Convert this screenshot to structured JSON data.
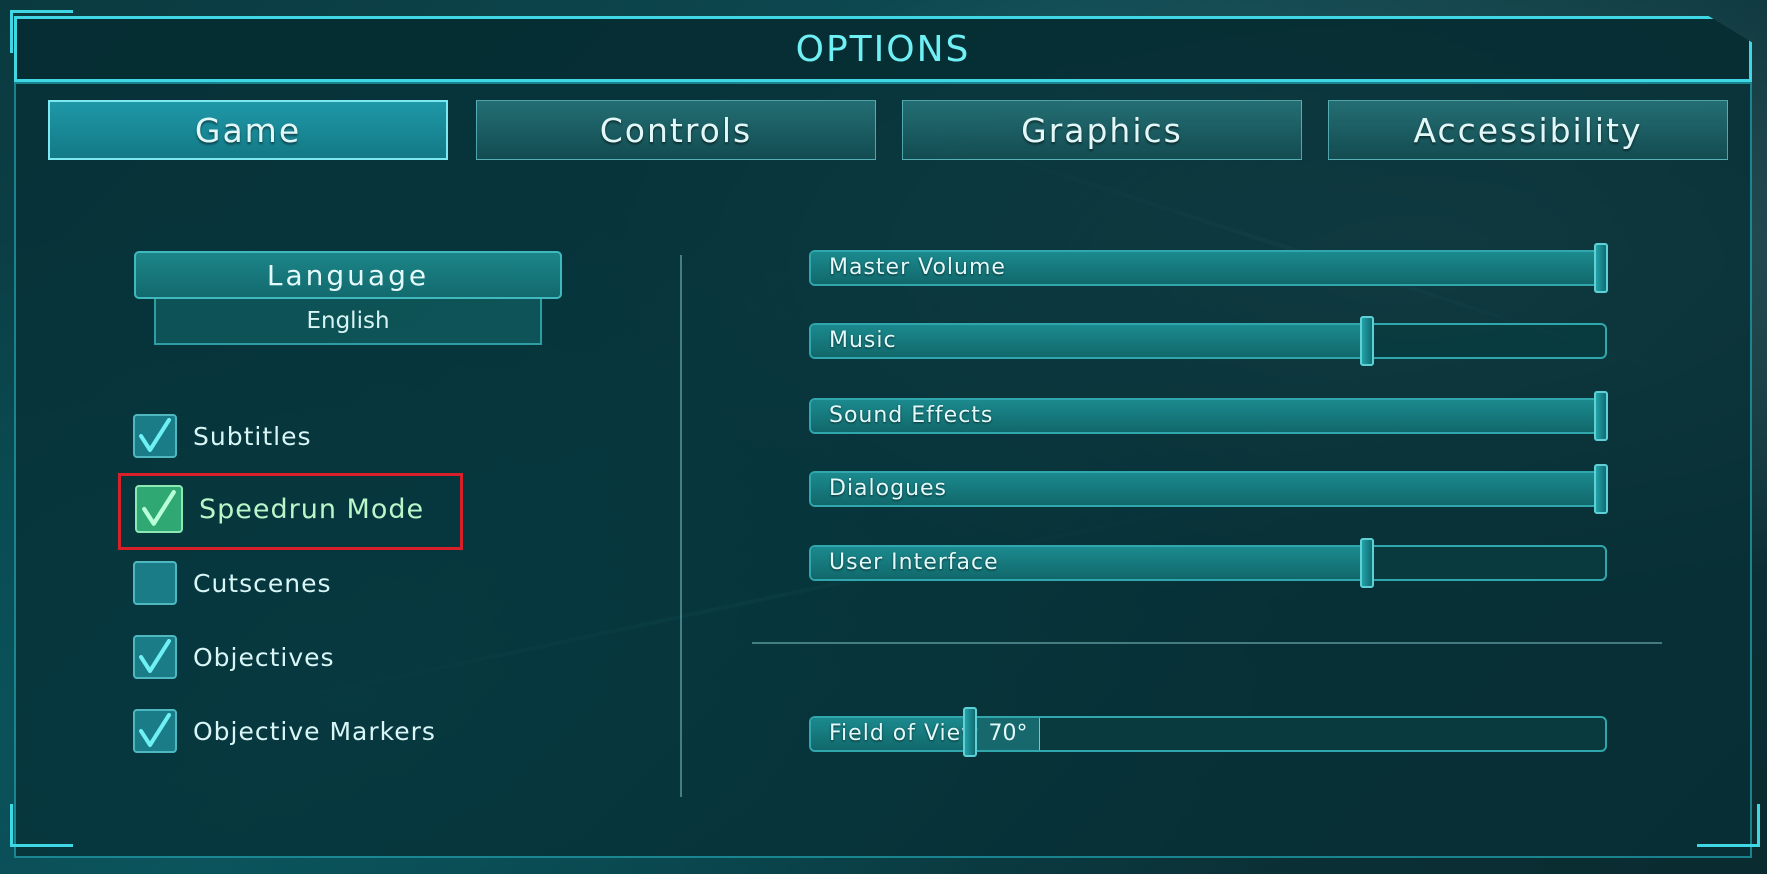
{
  "window": {
    "title": "OPTIONS"
  },
  "tabs": [
    {
      "label": "Game",
      "active": true
    },
    {
      "label": "Controls",
      "active": false
    },
    {
      "label": "Graphics",
      "active": false
    },
    {
      "label": "Accessibility",
      "active": false
    }
  ],
  "language": {
    "label": "Language",
    "value": "English"
  },
  "checkboxes": [
    {
      "label": "Subtitles",
      "checked": true
    },
    {
      "label": "Speedrun Mode",
      "checked": true,
      "highlighted": true
    },
    {
      "label": "Cutscenes",
      "checked": false
    },
    {
      "label": "Objectives",
      "checked": true
    },
    {
      "label": "Objective Markers",
      "checked": true
    }
  ],
  "volume_sliders": [
    {
      "label": "Master Volume",
      "level": 1.0
    },
    {
      "label": "Music",
      "level": 0.7
    },
    {
      "label": "Sound Effects",
      "level": 1.0
    },
    {
      "label": "Dialogues",
      "level": 1.0
    },
    {
      "label": "User Interface",
      "level": 0.7
    }
  ],
  "fov_slider": {
    "label": "Field of View",
    "value_text": "70°",
    "level": 0.2
  },
  "colors": {
    "accent": "#3fd7e4",
    "highlight": "#d8202a",
    "check_mark": "#6ff0f5"
  }
}
